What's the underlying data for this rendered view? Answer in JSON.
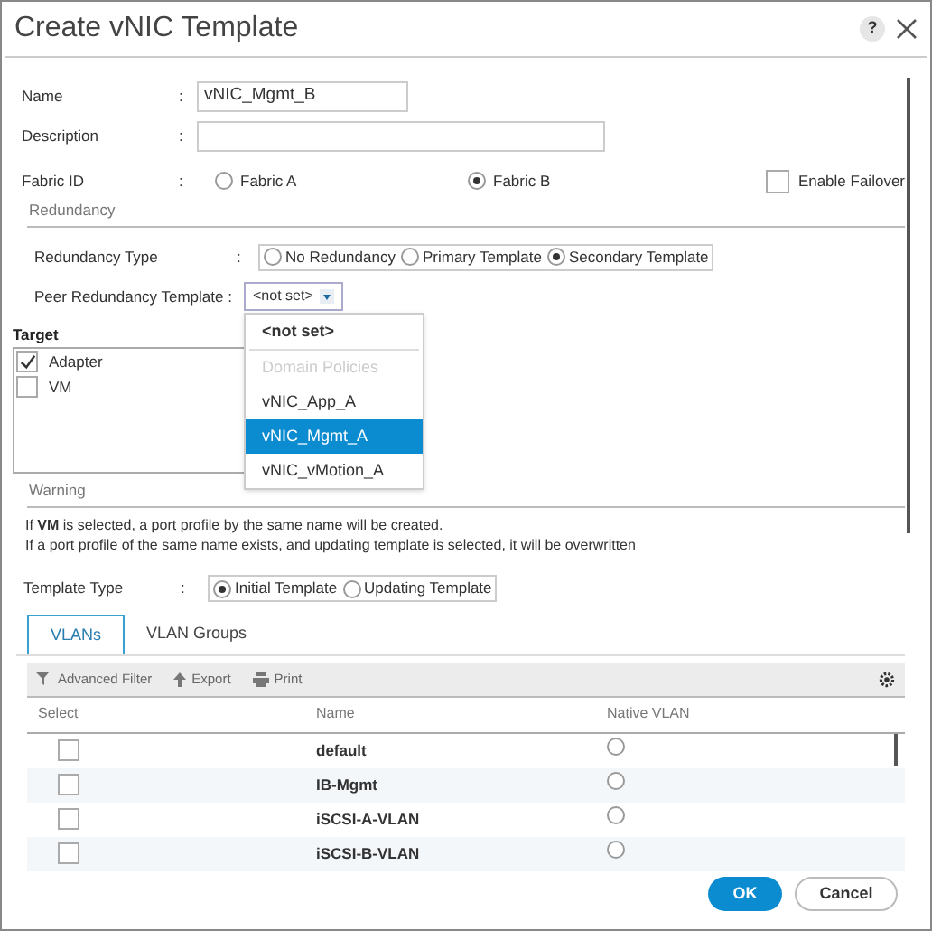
{
  "dialog": {
    "title": "Create vNIC Template",
    "help": "?"
  },
  "fields": [
    {
      "label": "Name",
      "colon": ":",
      "value": "vNIC_Mgmt_B"
    },
    {
      "label": "Description",
      "colon": ":"
    }
  ],
  "fabric_id": {
    "label": "Fabric ID",
    "colon": ":",
    "options": [
      {
        "label": "Fabric A",
        "selected": false
      },
      {
        "label": "Fabric B",
        "selected": true
      }
    ],
    "enable_failover": {
      "label": "Enable Failover",
      "checked": false
    }
  },
  "redundancy": {
    "heading": "Redundancy",
    "type": {
      "label": "Redundancy Type",
      "colon": ":",
      "options": [
        {
          "label": "No Redundancy",
          "selected": false
        },
        {
          "label": "Primary Template",
          "selected": false
        },
        {
          "label": "Secondary Template",
          "selected": true
        }
      ]
    },
    "peer": {
      "label": "Peer Redundancy Template :",
      "value": "<not set>",
      "expanded": true,
      "options": [
        {
          "kind": "default",
          "label": "<not set>",
          "selected": true,
          "highlighted": false
        },
        {
          "kind": "group",
          "label": "Domain Policies"
        },
        {
          "kind": "option",
          "label": "vNIC_App_A",
          "selected": false,
          "highlighted": false
        },
        {
          "kind": "option",
          "label": "vNIC_Mgmt_A",
          "selected": false,
          "highlighted": true
        },
        {
          "kind": "option",
          "label": "vNIC_vMotion_A",
          "selected": false,
          "highlighted": false
        }
      ]
    }
  },
  "target": {
    "heading": "Target",
    "items": [
      {
        "label": "Adapter",
        "checked": true
      },
      {
        "label": "VM",
        "checked": false
      }
    ]
  },
  "warning": {
    "heading": "Warning",
    "lines": [
      "If **VM** is selected, a port profile by the same name will be created.",
      "If a port profile of the same name exists, and updating template is selected, it will be overwritten"
    ]
  },
  "template_type": {
    "label": "Template Type",
    "colon": ":",
    "options": [
      {
        "label": "Initial Template",
        "selected": true
      },
      {
        "label": "Updating Template",
        "selected": false
      }
    ]
  },
  "tabs": [
    {
      "label": "VLANs",
      "selected": true
    },
    {
      "label": "VLAN Groups",
      "selected": false
    }
  ],
  "toolbar": [
    {
      "kind": "filter",
      "label": "Advanced Filter"
    },
    {
      "kind": "export",
      "label": "Export"
    },
    {
      "kind": "print",
      "label": "Print"
    }
  ],
  "table": {
    "columns": [
      "Select",
      "Name",
      "Native VLAN"
    ],
    "rows": [
      {
        "name": "default",
        "checked": false,
        "native": false
      },
      {
        "name": "IB-Mgmt",
        "checked": false,
        "native": false
      },
      {
        "name": "iSCSI-A-VLAN",
        "checked": false,
        "native": false
      },
      {
        "name": "iSCSI-B-VLAN",
        "checked": false,
        "native": false
      }
    ]
  },
  "buttons": [
    {
      "kind": "primary",
      "label": "OK"
    },
    {
      "kind": "secondary",
      "label": "Cancel"
    }
  ]
}
